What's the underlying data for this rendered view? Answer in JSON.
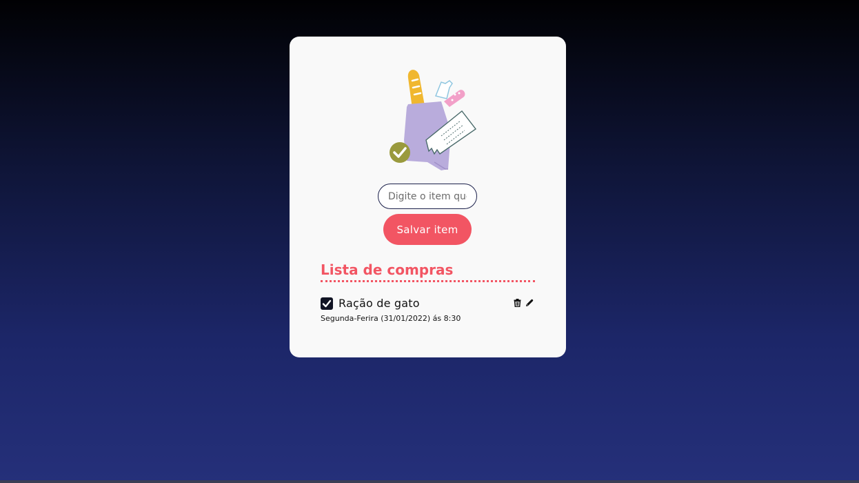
{
  "form": {
    "input_placeholder": "Digite o item que deseja adicionar",
    "input_value": "",
    "save_label": "Salvar item"
  },
  "list": {
    "title": "Lista de compras",
    "items": [
      {
        "name": "Ração de gato",
        "date": "Segunda-Ferira (31/01/2022) ás 8:30",
        "checked": true
      }
    ]
  },
  "icons": {
    "illustration": "grocery-bag-illustration-icon",
    "checkbox": "checkmark-icon",
    "delete": "trash-icon",
    "edit": "pencil-icon"
  },
  "colors": {
    "accent": "#f25563",
    "card_background": "#f9f9f9",
    "dark": "#111424",
    "bag": "#b9acdc",
    "bread": "#f0b72f",
    "check_badge": "#9a9a3d"
  }
}
